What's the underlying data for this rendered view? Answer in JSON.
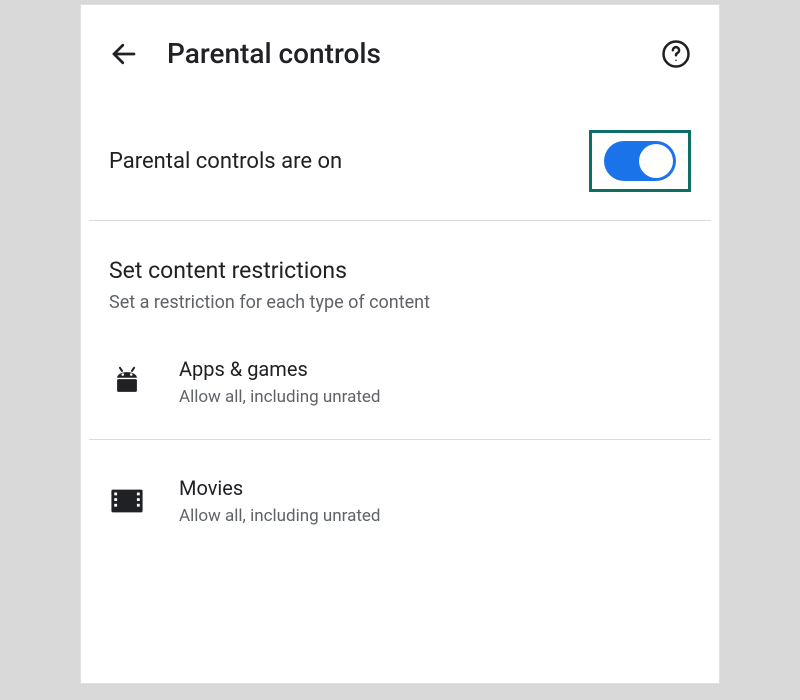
{
  "header": {
    "title": "Parental controls"
  },
  "toggle": {
    "label": "Parental controls are on",
    "on": true
  },
  "section": {
    "title": "Set content restrictions",
    "subtitle": "Set a restriction for each type of content"
  },
  "items": [
    {
      "title": "Apps & games",
      "subtitle": "Allow all, including unrated",
      "icon": "android-icon"
    },
    {
      "title": "Movies",
      "subtitle": "Allow all, including unrated",
      "icon": "film-icon"
    }
  ]
}
